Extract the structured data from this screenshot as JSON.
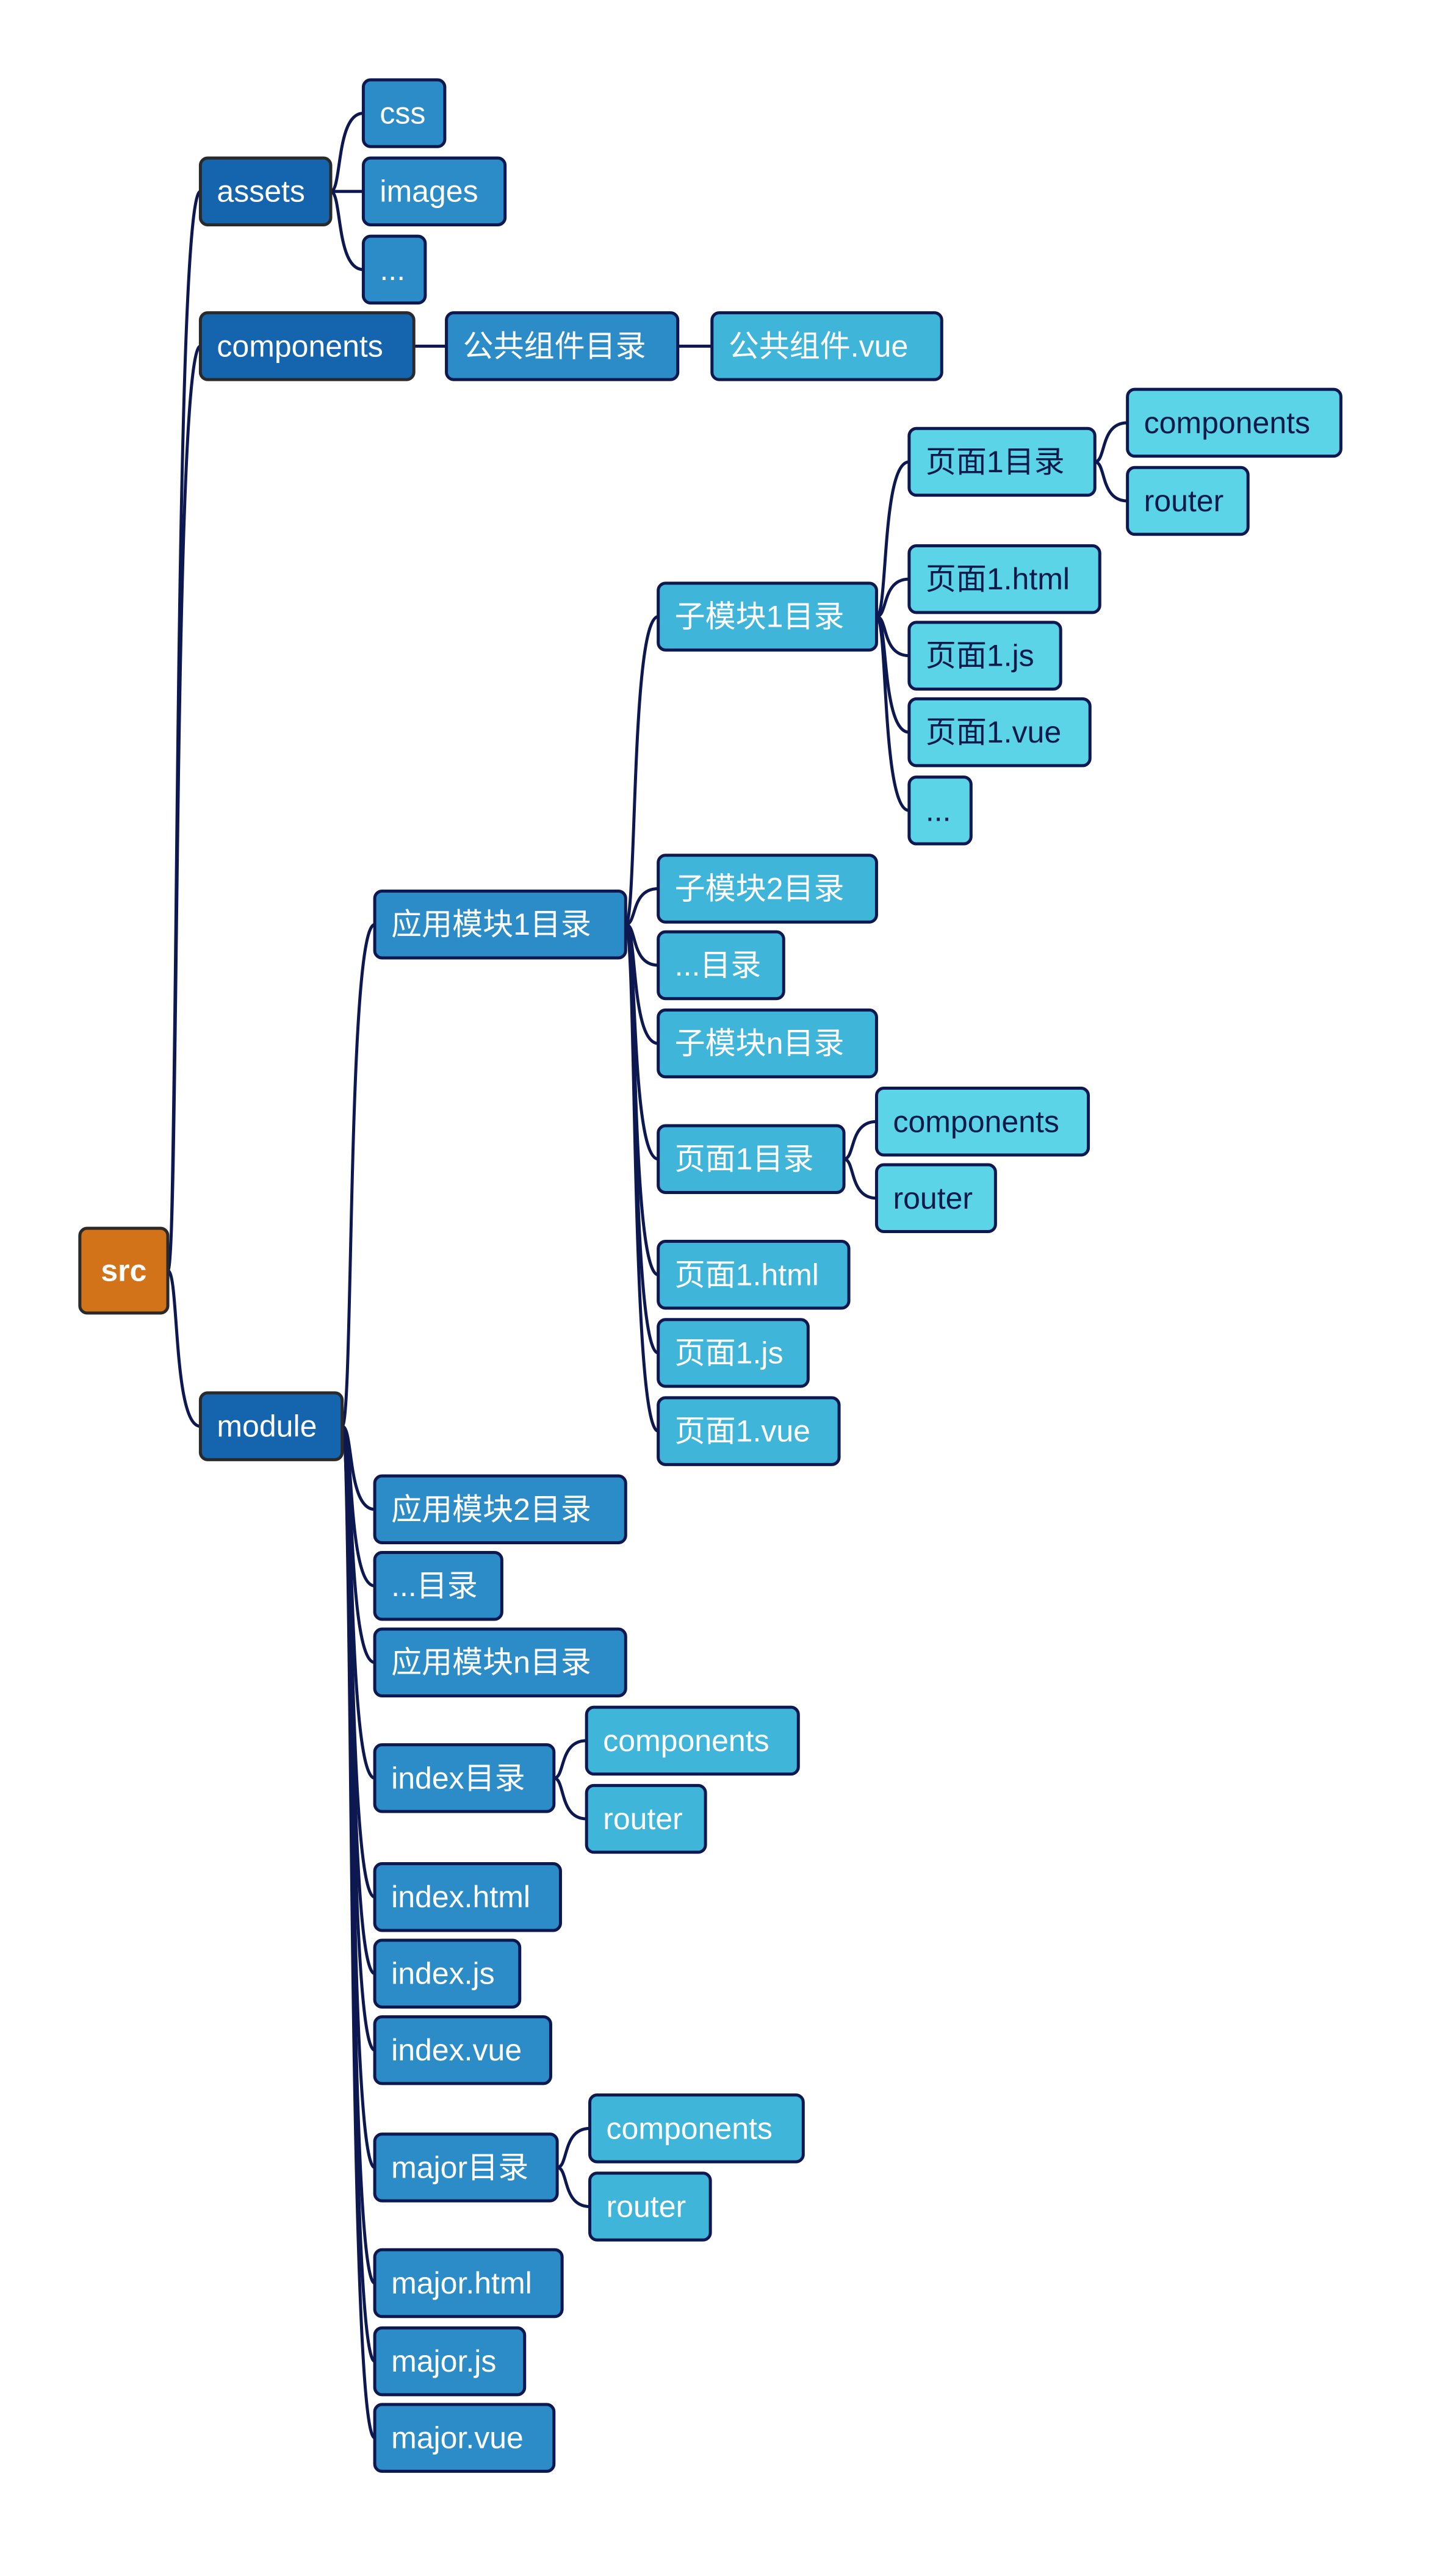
{
  "diagram": {
    "type": "mind-map",
    "colors": {
      "root": "#D2731A",
      "level1": "#1464AE",
      "level2": "#2B8CC8",
      "level3": "#40B5DA",
      "level4": "#5AD4E6",
      "connector": "#0D1850",
      "text_light": "#FFFFFF",
      "text_dark": "#0A1A4A"
    },
    "nodes": [
      {
        "id": "src",
        "label": "src",
        "level": 0,
        "parent": null
      },
      {
        "id": "assets",
        "label": "assets",
        "level": 1,
        "parent": "src"
      },
      {
        "id": "components",
        "label": "components",
        "level": 1,
        "parent": "src"
      },
      {
        "id": "module",
        "label": "module",
        "level": 1,
        "parent": "src"
      },
      {
        "id": "css",
        "label": "css",
        "level": 2,
        "parent": "assets"
      },
      {
        "id": "images",
        "label": "images",
        "level": 2,
        "parent": "assets"
      },
      {
        "id": "assets-more",
        "label": "...",
        "level": 2,
        "parent": "assets"
      },
      {
        "id": "common-dir",
        "label": "公共组件目录",
        "level": 2,
        "parent": "components"
      },
      {
        "id": "common-vue",
        "label": "公共组件.vue",
        "level": 3,
        "parent": "common-dir"
      },
      {
        "id": "app1",
        "label": "应用模块1目录",
        "level": 2,
        "parent": "module"
      },
      {
        "id": "sub1",
        "label": "子模块1目录",
        "level": 3,
        "parent": "app1"
      },
      {
        "id": "sub1-page-dir",
        "label": "页面1目录",
        "level": 4,
        "parent": "sub1"
      },
      {
        "id": "sub1-page-components",
        "label": "components",
        "level": 4,
        "parent": "sub1-page-dir"
      },
      {
        "id": "sub1-page-router",
        "label": "router",
        "level": 4,
        "parent": "sub1-page-dir"
      },
      {
        "id": "sub1-page-html",
        "label": "页面1.html",
        "level": 4,
        "parent": "sub1"
      },
      {
        "id": "sub1-page-js",
        "label": "页面1.js",
        "level": 4,
        "parent": "sub1"
      },
      {
        "id": "sub1-page-vue",
        "label": "页面1.vue",
        "level": 4,
        "parent": "sub1"
      },
      {
        "id": "sub1-more",
        "label": "...",
        "level": 4,
        "parent": "sub1"
      },
      {
        "id": "sub2",
        "label": "子模块2目录",
        "level": 3,
        "parent": "app1"
      },
      {
        "id": "sub-more",
        "label": "...目录",
        "level": 3,
        "parent": "app1"
      },
      {
        "id": "subn",
        "label": "子模块n目录",
        "level": 3,
        "parent": "app1"
      },
      {
        "id": "app1-page-dir",
        "label": "页面1目录",
        "level": 3,
        "parent": "app1"
      },
      {
        "id": "app1-page-components",
        "label": "components",
        "level": 4,
        "parent": "app1-page-dir"
      },
      {
        "id": "app1-page-router",
        "label": "router",
        "level": 4,
        "parent": "app1-page-dir"
      },
      {
        "id": "app1-page-html",
        "label": "页面1.html",
        "level": 3,
        "parent": "app1"
      },
      {
        "id": "app1-page-js",
        "label": "页面1.js",
        "level": 3,
        "parent": "app1"
      },
      {
        "id": "app1-page-vue",
        "label": "页面1.vue",
        "level": 3,
        "parent": "app1"
      },
      {
        "id": "app2",
        "label": "应用模块2目录",
        "level": 2,
        "parent": "module"
      },
      {
        "id": "app-more",
        "label": "...目录",
        "level": 2,
        "parent": "module"
      },
      {
        "id": "appn",
        "label": "应用模块n目录",
        "level": 2,
        "parent": "module"
      },
      {
        "id": "index-dir",
        "label": "index目录",
        "level": 2,
        "parent": "module"
      },
      {
        "id": "index-components",
        "label": "components",
        "level": 3,
        "parent": "index-dir"
      },
      {
        "id": "index-router",
        "label": "router",
        "level": 3,
        "parent": "index-dir"
      },
      {
        "id": "index-html",
        "label": "index.html",
        "level": 2,
        "parent": "module"
      },
      {
        "id": "index-js",
        "label": "index.js",
        "level": 2,
        "parent": "module"
      },
      {
        "id": "index-vue",
        "label": "index.vue",
        "level": 2,
        "parent": "module"
      },
      {
        "id": "major-dir",
        "label": "major目录",
        "level": 2,
        "parent": "module"
      },
      {
        "id": "major-components",
        "label": "components",
        "level": 3,
        "parent": "major-dir"
      },
      {
        "id": "major-router",
        "label": "router",
        "level": 3,
        "parent": "major-dir"
      },
      {
        "id": "major-html",
        "label": "major.html",
        "level": 2,
        "parent": "module"
      },
      {
        "id": "major-js",
        "label": "major.js",
        "level": 2,
        "parent": "module"
      },
      {
        "id": "major-vue",
        "label": "major.vue",
        "level": 2,
        "parent": "module"
      }
    ]
  }
}
